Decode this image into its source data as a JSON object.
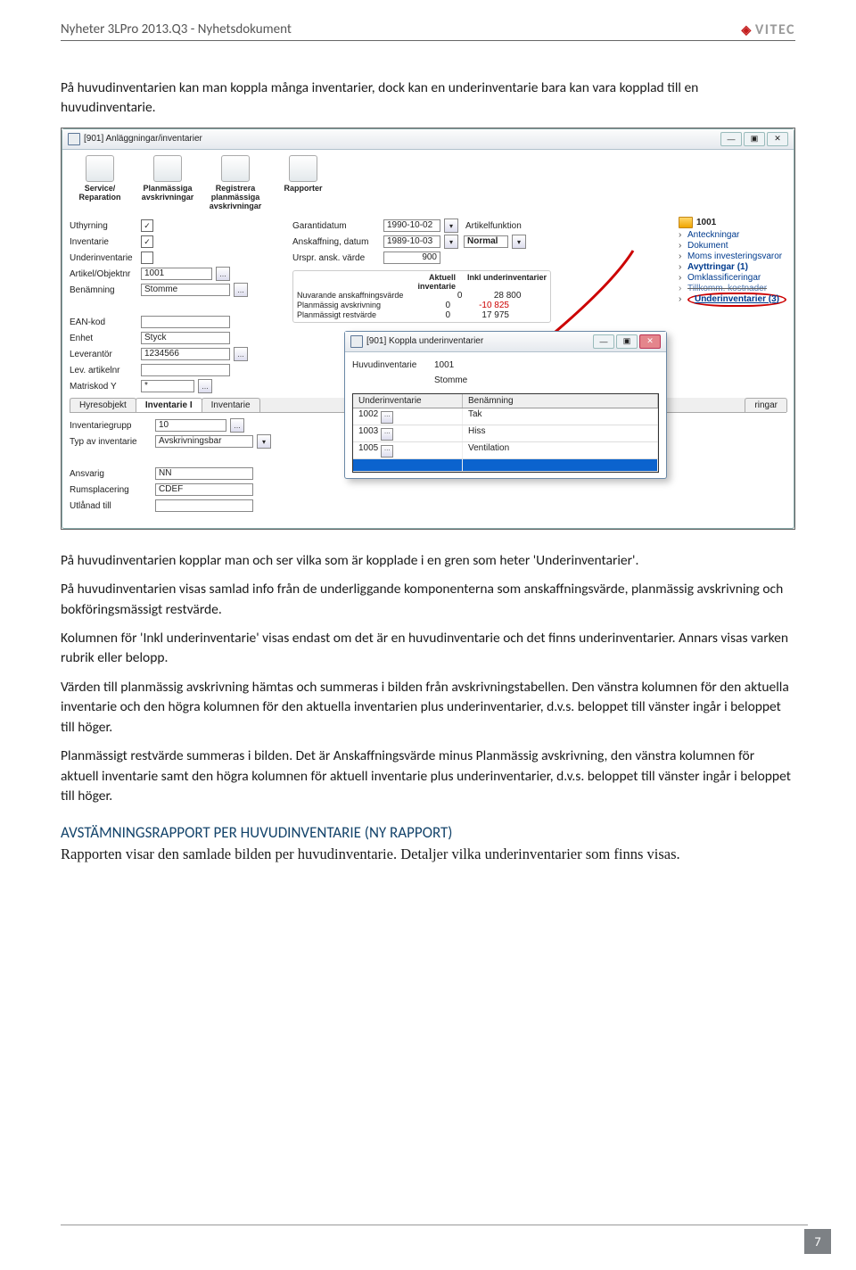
{
  "header": {
    "title": "Nyheter 3LPro 2013.Q3 - Nyhetsdokument",
    "brand": "VITEC"
  },
  "intro": "På huvudinventarien kan man koppla många inventarier, dock kan en underinventarie bara kan vara kopplad till en huvudinventarie.",
  "win1": {
    "title": "[901] Anläggningar/inventarier",
    "toolbar": [
      {
        "label": "Service/\nReparation"
      },
      {
        "label": "Planmässiga\navskrivningar"
      },
      {
        "label": "Registrera\nplanmässiga\navskrivningar"
      },
      {
        "label": "Rapporter"
      }
    ],
    "left": {
      "uthyrning_chk": "✓",
      "uthyrning": "Uthyrning",
      "inventarie_chk": "✓",
      "inventarie": "Inventarie",
      "underinv": "Underinventarie",
      "artikel_lbl": "Artikel/Objektnr",
      "artikel": "1001",
      "benamn_lbl": "Benämning",
      "benamn": "Stomme",
      "ean": "EAN-kod",
      "enhet_lbl": "Enhet",
      "enhet": "Styck",
      "lever_lbl": "Leverantör",
      "lever": "1234566",
      "levart": "Lev. artikelnr",
      "matris_lbl": "Matriskod Y",
      "matris": "*"
    },
    "mid": {
      "garanti_lbl": "Garantidatum",
      "garanti": "1990-10-02",
      "af_lbl": "Artikelfunktion",
      "ansk_lbl": "Anskaffning, datum",
      "ansk": "1989-10-03",
      "normal": "Normal",
      "urspr_lbl": "Urspr. ansk. värde",
      "urspr": "900",
      "sum_h1": "Aktuell inventarie",
      "sum_h2": "Inkl underinventarier",
      "rows": [
        {
          "lbl": "Nuvarande anskaffningsvärde",
          "v1": "0",
          "v2": "28 800"
        },
        {
          "lbl": "Planmässig avskrivning",
          "v1": "0",
          "v2": "-10 825",
          "neg": true
        },
        {
          "lbl": "Planmässigt restvärde",
          "v1": "0",
          "v2": "17 975"
        }
      ]
    },
    "right": {
      "folder": "1001",
      "items": [
        {
          "t": "Anteckningar"
        },
        {
          "t": "Dokument"
        },
        {
          "t": "Moms investeringsvaror"
        },
        {
          "t": "Avyttringar (1)",
          "bold": true
        },
        {
          "t": "Omklassificeringar"
        },
        {
          "t": "Tillkomm. kostnader"
        },
        {
          "t": "Underinventarier (3)",
          "bold": true,
          "under": true,
          "ring": true
        }
      ]
    },
    "tabs": {
      "items": [
        "Hyresobjekt",
        "Inventarie I",
        "Inventarie"
      ],
      "active": 1,
      "extra_tab": "ringar",
      "body": {
        "grupp_lbl": "Inventariegrupp",
        "grupp": "10",
        "typ_lbl": "Typ av inventarie",
        "typ": "Avskrivningsbar",
        "ansv_lbl": "Ansvarig",
        "ansv": "NN",
        "rums_lbl": "Rumsplacering",
        "rums": "CDEF",
        "utl": "Utlånad till"
      }
    }
  },
  "sub": {
    "title": "[901] Koppla underinventarier",
    "hi_lbl": "Huvudinventarie",
    "hi_val": "1001",
    "hi_name": "Stomme",
    "h1": "Underinventarie",
    "h2": "Benämning",
    "rows": [
      {
        "a": "1002",
        "b": "Tak"
      },
      {
        "a": "1003",
        "b": "Hiss"
      },
      {
        "a": "1005",
        "b": "Ventilation"
      }
    ]
  },
  "para": {
    "p1": "På huvudinventarien kopplar man och ser vilka som är kopplade i en gren som heter 'Underinventarier'.",
    "p2": "På huvudinventarien visas samlad info från de underliggande komponenterna som anskaffningsvärde, planmässig avskrivning och bokföringsmässigt restvärde.",
    "p3": "Kolumnen för 'Inkl underinventarie' visas endast om det är en huvudinventarie och det finns underinventarier. Annars visas varken rubrik eller belopp.",
    "p4": "Värden till planmässig avskrivning hämtas och summeras i bilden från avskrivningstabellen. Den vänstra kolumnen för den aktuella inventarie och den högra kolumnen för den aktuella inventarien plus underinventarier, d.v.s. beloppet till vänster ingår i beloppet till höger.",
    "p5": "Planmässigt restvärde summeras i bilden. Det är Anskaffningsvärde minus Planmässig avskrivning, den vänstra kolumnen för aktuell inventarie samt den högra kolumnen för aktuell inventarie plus underinventarier, d.v.s. beloppet till vänster ingår i beloppet till höger."
  },
  "h3": "AVSTÄMNINGSRAPPORT PER HUVUDINVENTARIE (NY RAPPORT)",
  "subtext": "Rapporten visar den samlade bilden per huvudinventarie. Detaljer vilka underinventarier som finns visas.",
  "pagenum": "7"
}
